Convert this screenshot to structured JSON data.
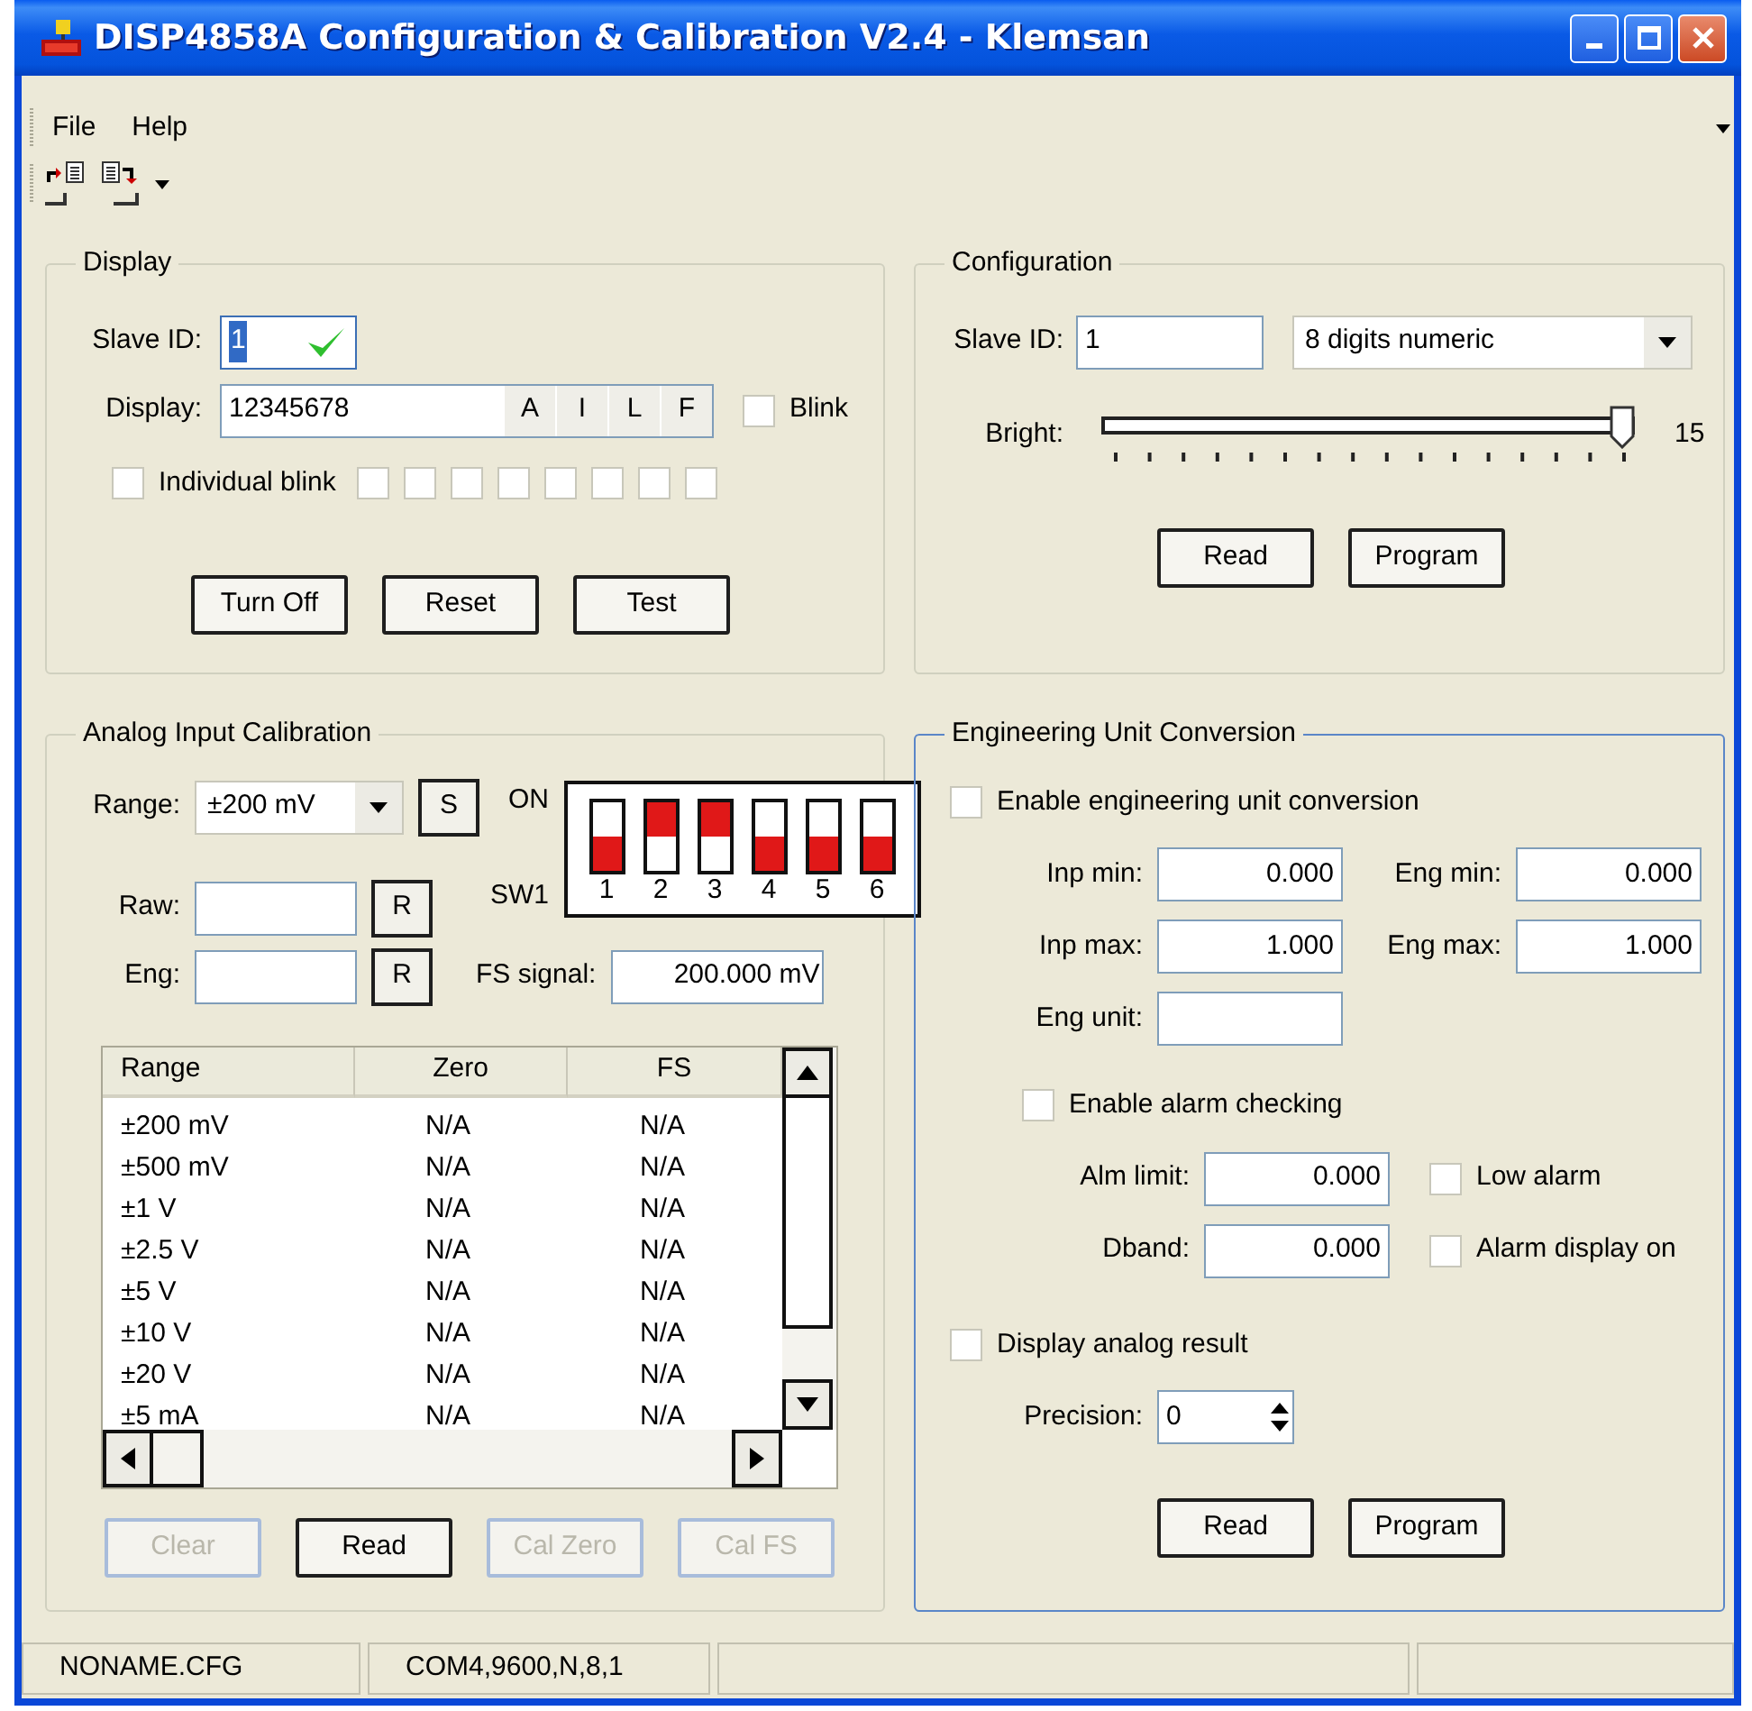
{
  "window": {
    "title": "DISP4858A Configuration & Calibration V2.4 - Klemsan"
  },
  "menu": [
    {
      "label": "File"
    },
    {
      "label": "Help"
    }
  ],
  "display": {
    "title": "Display",
    "focused": false,
    "slave_id_label": "Slave ID:",
    "slave_id": "1",
    "display_label": "Display:",
    "display_value": "12345678",
    "char_buttons": [
      "A",
      "I",
      "L",
      "F"
    ],
    "blink": {
      "label": "Blink",
      "checked": false
    },
    "individual_blink": {
      "label": "Individual blink",
      "checked": false
    },
    "digit_blinks": [
      {
        "checked": false
      },
      {
        "checked": false
      },
      {
        "checked": false
      },
      {
        "checked": false
      },
      {
        "checked": false
      },
      {
        "checked": false
      },
      {
        "checked": false
      },
      {
        "checked": false
      }
    ],
    "buttons": [
      {
        "label": "Turn Off",
        "disabled": false
      },
      {
        "label": "Reset",
        "disabled": false
      },
      {
        "label": "Test",
        "disabled": false
      }
    ]
  },
  "configuration": {
    "title": "Configuration",
    "focused": false,
    "slave_id_label": "Slave ID:",
    "slave_id": "1",
    "mode": "8 digits numeric",
    "bright_label": "Bright:",
    "bright": {
      "level": 1
    },
    "bright_value": "15",
    "buttons": [
      {
        "label": "Read",
        "disabled": false
      },
      {
        "label": "Program",
        "disabled": false
      }
    ]
  },
  "analog": {
    "title": "Analog Input Calibration",
    "focused": false,
    "range_label": "Range:",
    "range": "±200 mV",
    "set_button": "S",
    "switch_on_label": "ON",
    "switch_name": "SW1",
    "switches": [
      {
        "label": "1",
        "on": false
      },
      {
        "label": "2",
        "on": true
      },
      {
        "label": "3",
        "on": true
      },
      {
        "label": "4",
        "on": false
      },
      {
        "label": "5",
        "on": false
      },
      {
        "label": "6",
        "on": false
      }
    ],
    "raw_label": "Raw:",
    "raw_button": "R",
    "eng_label": "Eng:",
    "eng_button": "R",
    "fs_label": "FS signal:",
    "fs_value": "200.000 mV",
    "table": {
      "columns": [
        "Range",
        "Zero",
        "FS"
      ],
      "rows": [
        [
          "±200 mV",
          "N/A",
          "N/A"
        ],
        [
          "±500 mV",
          "N/A",
          "N/A"
        ],
        [
          "±1 V",
          "N/A",
          "N/A"
        ],
        [
          "±2.5 V",
          "N/A",
          "N/A"
        ],
        [
          "±5 V",
          "N/A",
          "N/A"
        ],
        [
          "±10 V",
          "N/A",
          "N/A"
        ],
        [
          "±20 V",
          "N/A",
          "N/A"
        ],
        [
          "±5 mA",
          "N/A",
          "N/A"
        ]
      ]
    },
    "buttons": [
      {
        "label": "Clear",
        "disabled": true
      },
      {
        "label": "Read",
        "disabled": false
      },
      {
        "label": "Cal Zero",
        "disabled": true
      },
      {
        "label": "Cal FS",
        "disabled": true
      }
    ]
  },
  "engineering": {
    "title": "Engineering Unit Conversion",
    "focused": true,
    "enable": {
      "label": "Enable engineering unit conversion",
      "checked": false
    },
    "fields": [
      {
        "label": "Inp min:",
        "value": "0.000"
      },
      {
        "label": "Eng min:",
        "value": "0.000"
      },
      {
        "label": "Inp max:",
        "value": "1.000"
      },
      {
        "label": "Eng max:",
        "value": "1.000"
      },
      {
        "label": "Eng unit:"
      }
    ],
    "alarm": {
      "label": "Enable alarm checking",
      "checked": false
    },
    "alarm_fields": [
      {
        "label": "Alm limit:",
        "value": "0.000",
        "option": {
          "label": "Low alarm",
          "checked": false
        }
      },
      {
        "label": "Dband:",
        "value": "0.000",
        "option": {
          "label": "Alarm display on",
          "checked": false
        }
      }
    ],
    "analog_result": {
      "label": "Display analog result",
      "checked": false
    },
    "precision_label": "Precision:",
    "precision": "0",
    "buttons": [
      {
        "label": "Read",
        "disabled": false
      },
      {
        "label": "Program",
        "disabled": false
      }
    ]
  },
  "status_bar": [
    "NONAME.CFG",
    "COM4,9600,N,8,1"
  ]
}
